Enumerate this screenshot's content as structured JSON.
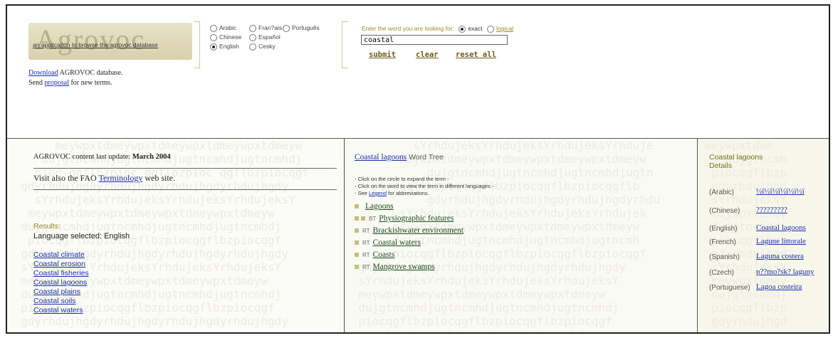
{
  "header": {
    "logo_word": "Agrovoc",
    "logo_tagline": "an application to browse the agrovoc database",
    "download_link": "Download",
    "download_text": " AGROVOC database.",
    "send_text": "Send ",
    "proposal_link": "proposal",
    "proposal_text": " for new terms."
  },
  "languages": {
    "arabic": "Arabic",
    "french": "Fran?ais",
    "portuguese": "Português",
    "chinese": "Chinese",
    "spanish": "Español",
    "english": "English",
    "czech": "Cesky",
    "selected": "English"
  },
  "search": {
    "label": "Enter the word you are looking for:",
    "exact": "exact",
    "logical": "logical",
    "mode": "exact",
    "value": "coastal",
    "submit": "submit",
    "clear": "clear",
    "reset": "reset all"
  },
  "left_panel": {
    "update_prefix": "AGROVOC content last update: ",
    "update_date": "March 2004",
    "visit_prefix": "Visit also the FAO ",
    "terminology_link": "Terminology",
    "visit_suffix": " web site.",
    "results_label": "Results:",
    "language_selected": "Language selected: English",
    "results": [
      "Coastal climate",
      "Coastal erosion",
      "Coastal fisheries",
      "Coastal lagoons",
      "Coastal plains",
      "Coastal soils",
      "Coastal waters"
    ]
  },
  "tree_panel": {
    "title_link": "Coastal lagoons",
    "title_suffix": " Word Tree",
    "instr1": "- Click on the circle to expand the term -",
    "instr2": "- Click on the word to view the term in different languages -",
    "instr3_prefix": "- See ",
    "legend_link": "Legend",
    "instr3_suffix": " for abbreviations.",
    "terms": [
      {
        "rel": "",
        "label": "Lagoons"
      },
      {
        "rel": "BT",
        "label": "Physiographic features"
      },
      {
        "rel": "RT",
        "label": "Brackishwater environment"
      },
      {
        "rel": "RT",
        "label": "Coastal waters"
      },
      {
        "rel": "RT",
        "label": "Coasts"
      },
      {
        "rel": "RT",
        "label": "Mangrove swamps"
      }
    ]
  },
  "details_panel": {
    "title": "Coastal lagoons",
    "subtitle": "Details",
    "rows": [
      {
        "lang": "(Arabic)",
        "value": "½ï½ï½ï½ï½ï½ï"
      },
      {
        "lang": "(Chinese)",
        "value": "?????????"
      },
      {
        "lang": "(English)",
        "value": "Coastal lagoons"
      },
      {
        "lang": "(French)",
        "value": "Lagune littorale"
      },
      {
        "lang": "(Spanish)",
        "value": "Laguna costera"
      },
      {
        "lang": "(Czech)",
        "value": "p??mo?sk? laguny"
      },
      {
        "lang": "(Portuguese)",
        "value": "Lagoa costeira"
      }
    ]
  },
  "background_pattern": "sYrhdujeksYrhduj meywpxtd dujgtncmhdjugtnc pioc qgflbzpioc",
  "colors": {
    "accent_olive": "#9a8b2a",
    "link_blue": "#1a2fa8",
    "term_green": "#1d4a1a",
    "logo_bg": "#d8d1ac"
  }
}
